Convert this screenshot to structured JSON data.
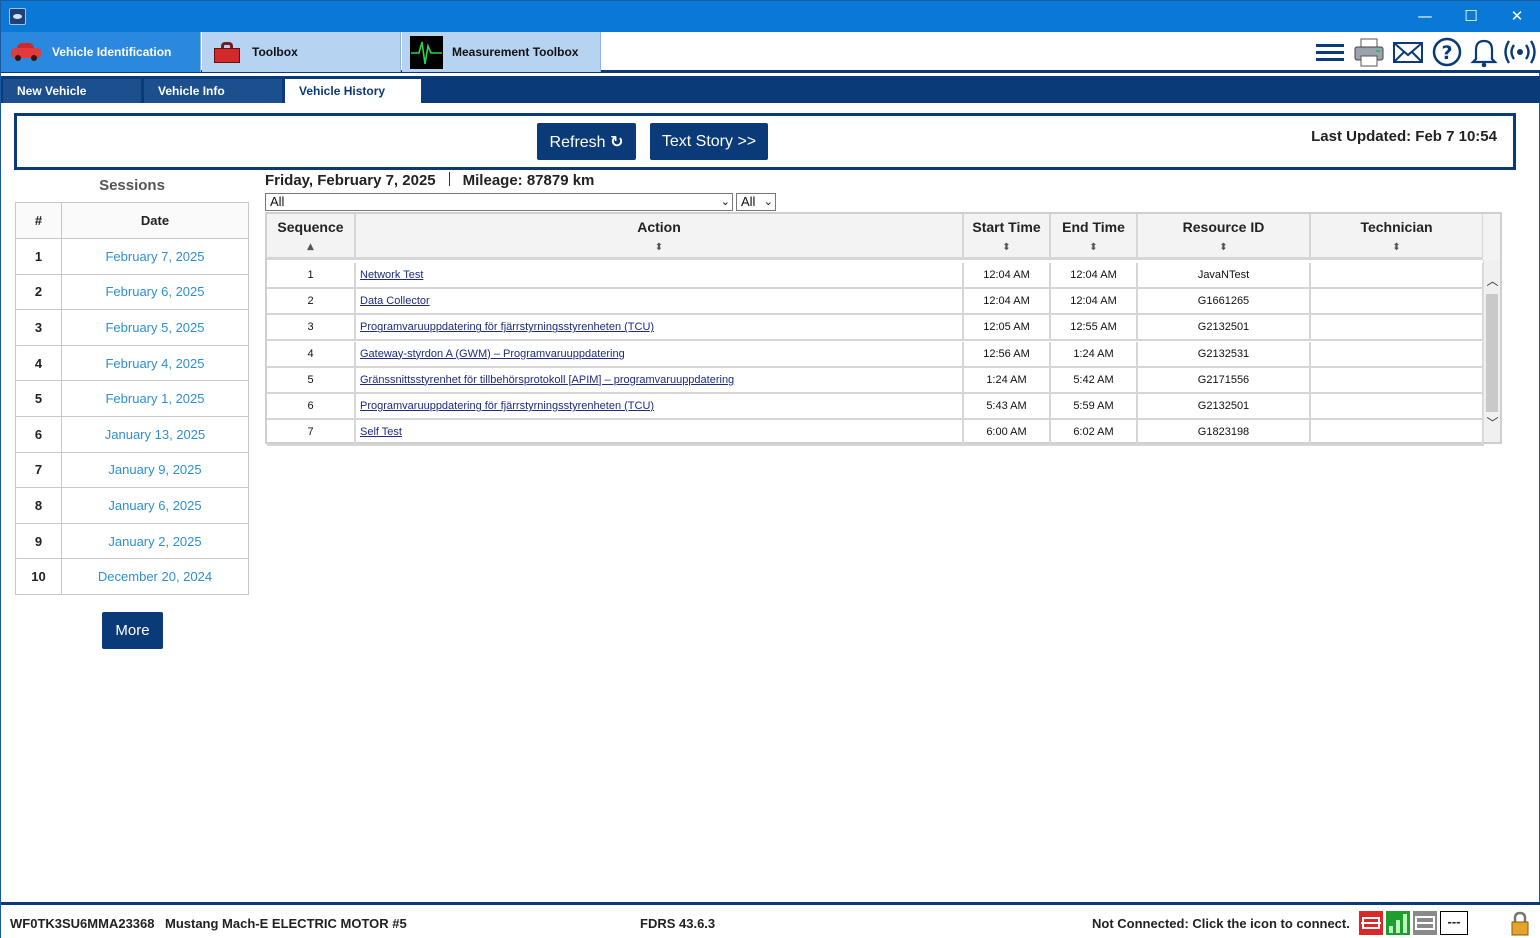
{
  "window": {
    "minimize": "—",
    "maximize": "☐",
    "close": "✕"
  },
  "main_tabs": [
    {
      "label": "Vehicle Identification",
      "icon": "car-icon",
      "active": true
    },
    {
      "label": "Toolbox",
      "icon": "toolbox-icon",
      "active": false
    },
    {
      "label": "Measurement Toolbox",
      "icon": "oscilloscope-icon",
      "active": false
    }
  ],
  "toolbar_icons": [
    "menu-icon",
    "printer-icon",
    "mail-icon",
    "help-icon",
    "bell-icon",
    "wireless-icon"
  ],
  "sub_tabs": [
    {
      "label": "New Vehicle",
      "active": false
    },
    {
      "label": "Vehicle Info",
      "active": false
    },
    {
      "label": "Vehicle History",
      "active": true
    }
  ],
  "actions": {
    "refresh_label": "Refresh",
    "refresh_icon": "refresh-icon",
    "text_story_label": "Text Story >>",
    "last_updated": "Last Updated: Feb 7 10:54"
  },
  "sessions": {
    "title": "Sessions",
    "col_num": "#",
    "col_date": "Date",
    "rows": [
      {
        "num": "1",
        "date": "February 7, 2025"
      },
      {
        "num": "2",
        "date": "February 6, 2025"
      },
      {
        "num": "3",
        "date": "February 5, 2025"
      },
      {
        "num": "4",
        "date": "February 4, 2025"
      },
      {
        "num": "5",
        "date": "February 1, 2025"
      },
      {
        "num": "6",
        "date": "January 13, 2025"
      },
      {
        "num": "7",
        "date": "January 9, 2025"
      },
      {
        "num": "8",
        "date": "January 6, 2025"
      },
      {
        "num": "9",
        "date": "January 2, 2025"
      },
      {
        "num": "10",
        "date": "December 20, 2024"
      }
    ],
    "more_label": "More"
  },
  "history": {
    "date": "Friday, February 7, 2025",
    "mileage": "Mileage: 87879 km",
    "filter_action": "All",
    "filter_second": "All",
    "columns": {
      "sequence": "Sequence",
      "action": "Action",
      "start": "Start Time",
      "end": "End Time",
      "resource": "Resource ID",
      "technician": "Technician"
    },
    "sort_asc": "▲",
    "sort_both": "⬍",
    "rows": [
      {
        "seq": "1",
        "action": "Network Test",
        "start": "12:04 AM",
        "end": "12:04 AM",
        "resource": "JavaNTest",
        "tech": ""
      },
      {
        "seq": "2",
        "action": "Data Collector",
        "start": "12:04 AM",
        "end": "12:04 AM",
        "resource": "G1661265",
        "tech": ""
      },
      {
        "seq": "3",
        "action": "Programvaruuppdatering för fjärrstyrningsstyrenheten (TCU)",
        "start": "12:05 AM",
        "end": "12:55 AM",
        "resource": "G2132501",
        "tech": ""
      },
      {
        "seq": "4",
        "action": "Gateway-styrdon A (GWM) – Programvaruuppdatering",
        "start": "12:56 AM",
        "end": "1:24 AM",
        "resource": "G2132531",
        "tech": ""
      },
      {
        "seq": "5",
        "action": "Gränssnittsstyrenhet för tillbehörsprotokoll [APIM] – programvaruuppdatering",
        "start": "1:24 AM",
        "end": "5:42 AM",
        "resource": "G2171556",
        "tech": ""
      },
      {
        "seq": "6",
        "action": "Programvaruuppdatering för fjärrstyrningsstyrenheten (TCU)",
        "start": "5:43 AM",
        "end": "5:59 AM",
        "resource": "G2132501",
        "tech": ""
      },
      {
        "seq": "7",
        "action": "Self Test",
        "start": "6:00 AM",
        "end": "6:02 AM",
        "resource": "G1823198",
        "tech": ""
      }
    ]
  },
  "status": {
    "vin": "WF0TK3SU6MMA23368",
    "model": "Mustang Mach-E ELECTRIC MOTOR #5",
    "version": "FDRS 43.6.3",
    "connection": "Not Connected: Click the icon to connect.",
    "icons": [
      "vci-disconnected-icon",
      "signal-bars-icon",
      "network-adapter-icon",
      "dashes-icon",
      "lock-icon"
    ],
    "dashes": "---"
  },
  "colors": {
    "titlebar": "#0a78d7",
    "navy": "#0a3a78",
    "link_blue": "#2e8fd6"
  }
}
